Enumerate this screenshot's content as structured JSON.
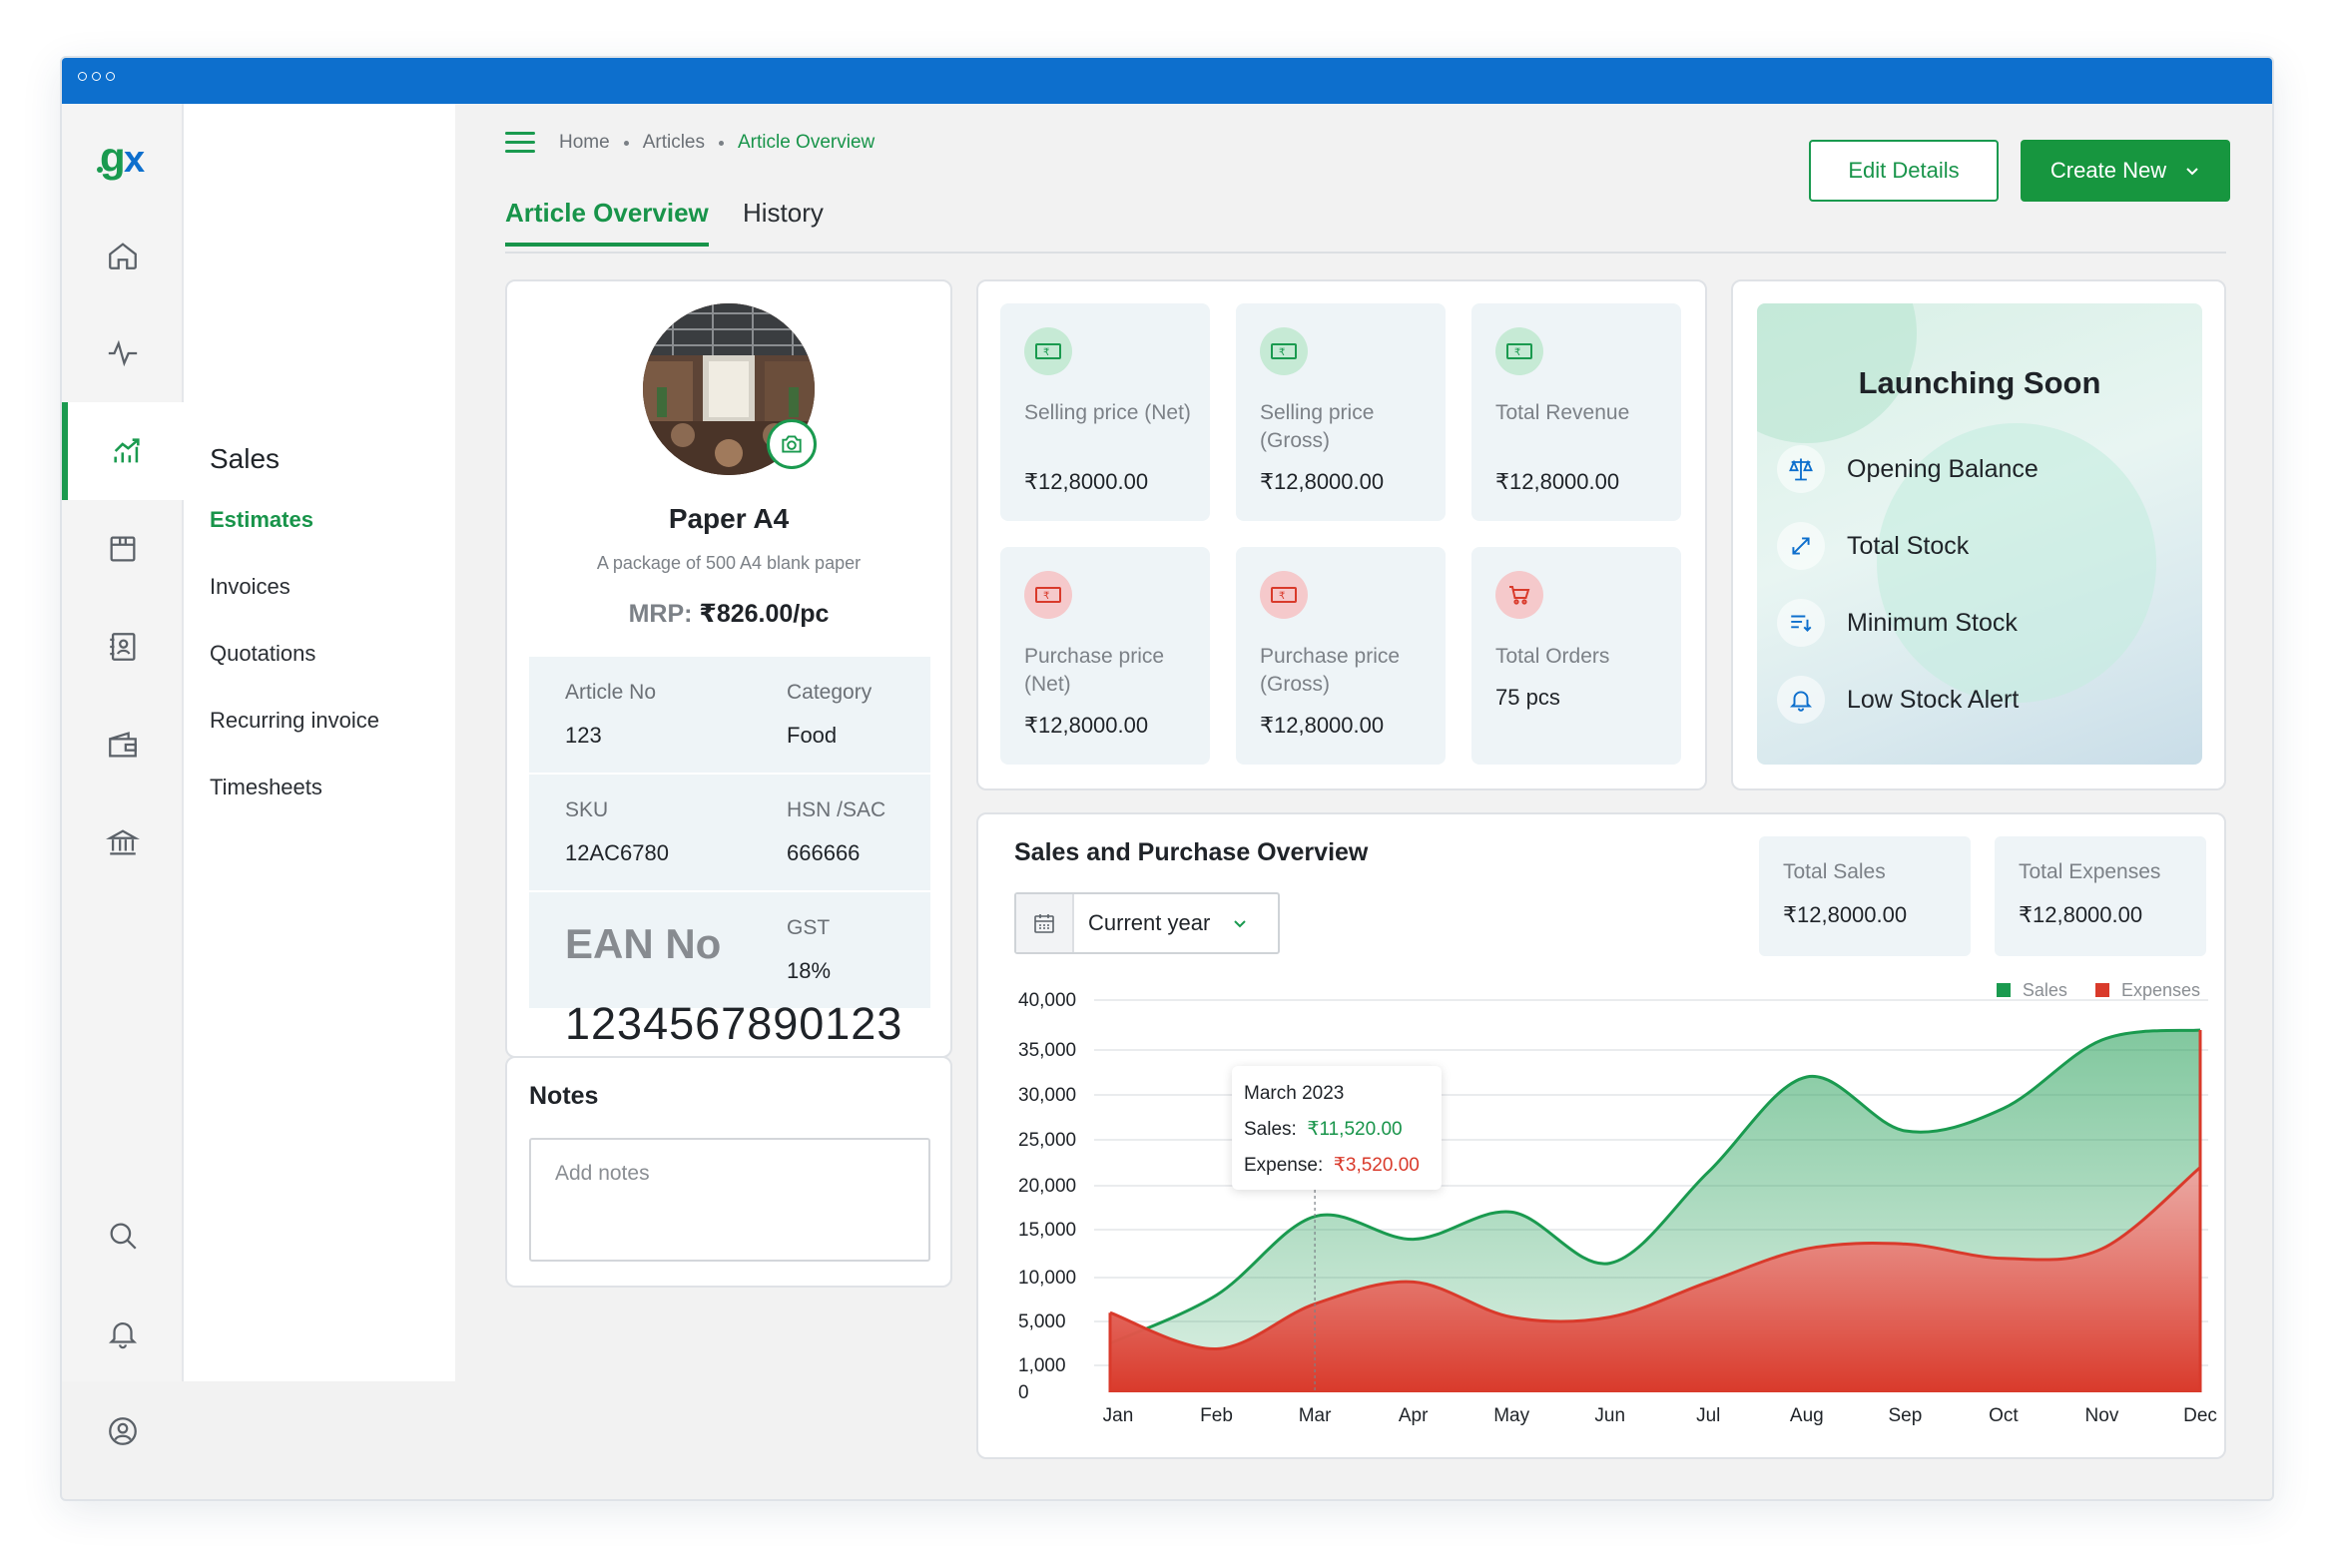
{
  "breadcrumb": [
    "Home",
    "Articles",
    "Article Overview"
  ],
  "actions": {
    "edit": "Edit Details",
    "create": "Create New"
  },
  "tabs": [
    "Article Overview",
    "History"
  ],
  "sidebar": {
    "title": "Sales",
    "items": [
      "Estimates",
      "Invoices",
      "Quotations",
      "Recurring invoice",
      "Timesheets"
    ]
  },
  "rail_icons": [
    "home-icon",
    "activity-icon",
    "sales-chart-icon",
    "inventory-icon",
    "contacts-icon",
    "wallet-icon",
    "bank-icon",
    "search-icon",
    "bell-icon",
    "profile-icon"
  ],
  "article": {
    "name": "Paper A4",
    "description": "A package of 500 A4 blank paper",
    "mrp_label": "MRP:",
    "mrp_value": "₹826.00/pc",
    "fields": [
      {
        "label": "Article No",
        "value": "123"
      },
      {
        "label": "Category",
        "value": "Food"
      },
      {
        "label": "SKU",
        "value": "12AC6780"
      },
      {
        "label": "HSN /SAC",
        "value": "666666"
      },
      {
        "label": "EAN No",
        "value": "1234567890123"
      },
      {
        "label": "GST",
        "value": "18%"
      }
    ]
  },
  "notes": {
    "title": "Notes",
    "placeholder": "Add notes"
  },
  "metrics": [
    {
      "label": "Selling price (Net)",
      "value": "₹12,8000.00",
      "icon": "cash-icon",
      "tone": "green"
    },
    {
      "label": "Selling price (Gross)",
      "value": "₹12,8000.00",
      "icon": "cash-icon",
      "tone": "green"
    },
    {
      "label": "Total Revenue",
      "value": "₹12,8000.00",
      "icon": "cash-icon",
      "tone": "green"
    },
    {
      "label": "Purchase price (Net)",
      "value": "₹12,8000.00",
      "icon": "cash-icon",
      "tone": "red"
    },
    {
      "label": "Purchase price (Gross)",
      "value": "₹12,8000.00",
      "icon": "cash-icon",
      "tone": "red"
    },
    {
      "label": "Total Orders",
      "value": "75 pcs",
      "icon": "cart-icon",
      "tone": "red"
    }
  ],
  "launching": {
    "title": "Launching Soon",
    "items": [
      {
        "label": "Opening Balance",
        "icon": "scale-icon"
      },
      {
        "label": "Total Stock",
        "icon": "expand-arrows-icon"
      },
      {
        "label": "Minimum Stock",
        "icon": "sort-down-icon"
      },
      {
        "label": "Low Stock Alert",
        "icon": "bell-icon"
      }
    ]
  },
  "overview": {
    "title": "Sales and Purchase Overview",
    "period": "Current year",
    "stats": [
      {
        "label": "Total Sales",
        "value": "₹12,8000.00"
      },
      {
        "label": "Total Expenses",
        "value": "₹12,8000.00"
      }
    ],
    "tooltip": {
      "title": "March 2023",
      "sales_label": "Sales:",
      "sales_value": "₹11,520.00",
      "expense_label": "Expense:",
      "expense_value": "₹3,520.00"
    }
  },
  "colors": {
    "accent": "#18944a",
    "sales": "#1a9a4f",
    "expenses": "#d93a2b",
    "titlebar": "#0d6fcd"
  },
  "chart_data": {
    "type": "area",
    "categories": [
      "Jan",
      "Feb",
      "Mar",
      "Apr",
      "May",
      "Jun",
      "Jul",
      "Aug",
      "Sep",
      "Oct",
      "Nov",
      "Dec"
    ],
    "y_ticks": [
      "0",
      "1,000",
      "5,000",
      "10,000",
      "15,000",
      "20,000",
      "25,000",
      "30,000",
      "35,000",
      "40,000"
    ],
    "ylim": [
      0,
      40000
    ],
    "series": [
      {
        "name": "Sales",
        "color": "#1a9a4f",
        "values": [
          3000,
          8000,
          16500,
          14000,
          17000,
          11500,
          21500,
          32000,
          26000,
          28500,
          36000,
          37000
        ]
      },
      {
        "name": "Expenses",
        "color": "#d93a2b",
        "values": [
          6000,
          2500,
          7000,
          9500,
          5500,
          5500,
          9500,
          13000,
          13500,
          12000,
          13000,
          22000
        ]
      }
    ],
    "legend": "top-right",
    "grid": true
  }
}
